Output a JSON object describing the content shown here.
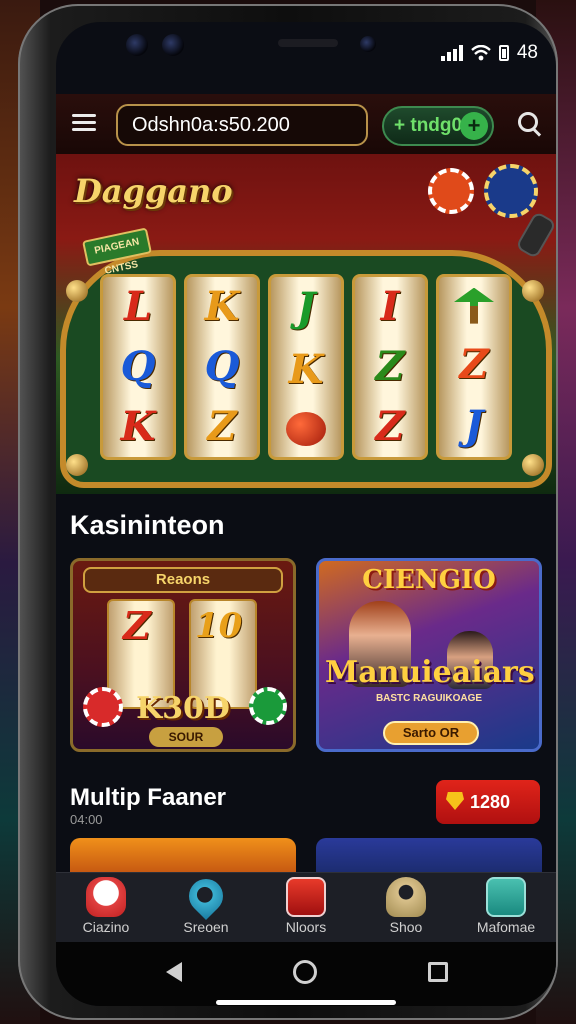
{
  "status_bar": {
    "time": "48"
  },
  "app_bar": {
    "search_text": "Odshn0a:s50.200",
    "cta_label": "+ tndg0",
    "cta_plus": "+"
  },
  "hero": {
    "brand": "Daggano",
    "reels_label": "PIAGEAN CNTSS",
    "reels": [
      [
        "L",
        "Q",
        "K"
      ],
      [
        "K",
        "Q",
        "Z"
      ],
      [
        "J",
        "K",
        "cherry"
      ],
      [
        "I",
        "Z",
        "Z"
      ],
      [
        "palm",
        "Z",
        "J"
      ]
    ]
  },
  "section1": {
    "title": "Kasininteon"
  },
  "cards": [
    {
      "top_label": "Reaons",
      "reel_values": [
        "Z",
        "10"
      ],
      "big": "K30D",
      "button": "SOUR"
    },
    {
      "title": "CIENGIO",
      "big": "Manuieaiars",
      "sub": "BASTC RAGUIKOAGE",
      "button": "Sarto OR"
    }
  ],
  "section2": {
    "title": "Multip Faaner",
    "subtitle": "04:00",
    "badge": "1280 CO"
  },
  "tabs": [
    {
      "label": "Ciazino",
      "icon": "tooth-icon"
    },
    {
      "label": "Sreoen",
      "icon": "pin-icon"
    },
    {
      "label": "Nloors",
      "icon": "gift-icon"
    },
    {
      "label": "Shoo",
      "icon": "person-icon"
    },
    {
      "label": "Mafomae",
      "icon": "machine-icon"
    }
  ],
  "colors": {
    "accent_gold": "#f6d46a",
    "accent_green": "#36b24a",
    "badge_red": "#e0241a"
  }
}
